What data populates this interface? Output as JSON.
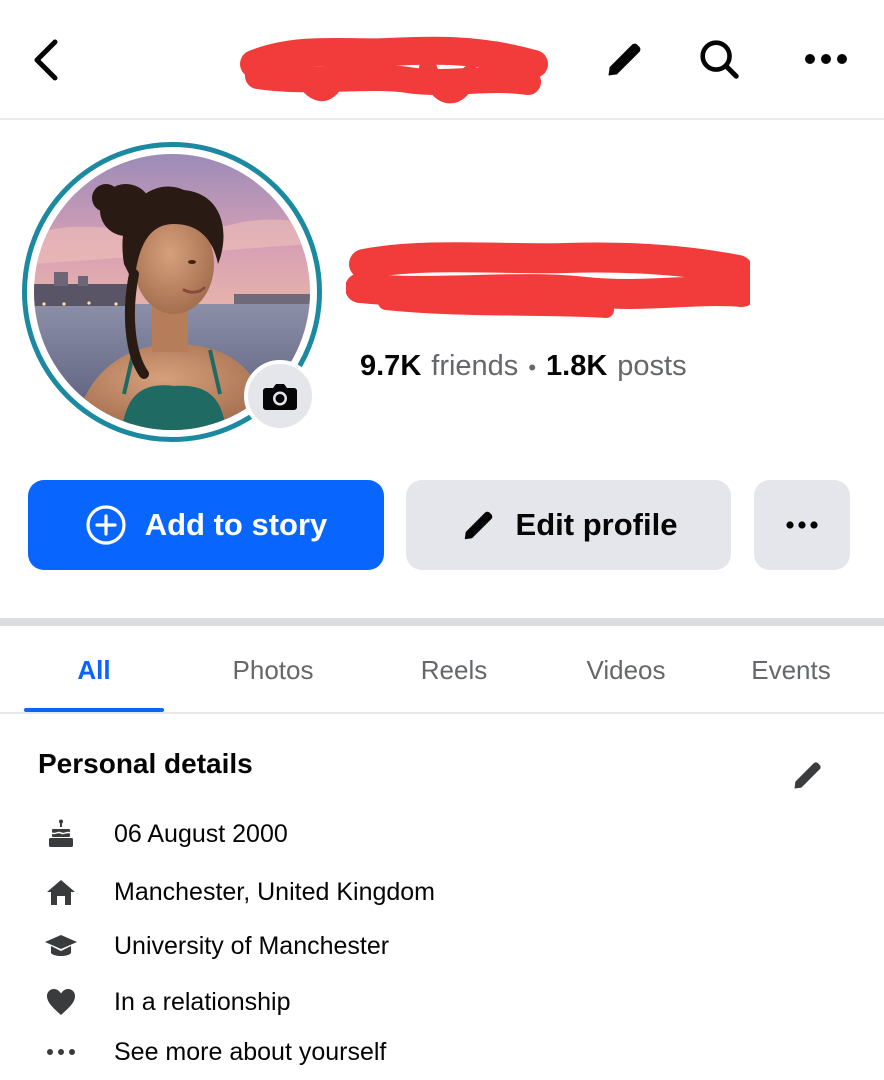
{
  "topbar": {
    "back_icon": "chevron-left-icon",
    "edit_icon": "pencil-icon",
    "search_icon": "search-icon",
    "more_icon": "more-dots-icon"
  },
  "profile": {
    "friends_count": "9.7K",
    "friends_label": "friends",
    "separator": "•",
    "posts_count": "1.8K",
    "posts_label": "posts"
  },
  "actions": {
    "add_story_label": "Add to story",
    "edit_profile_label": "Edit profile"
  },
  "tabs": [
    {
      "label": "All",
      "active": true
    },
    {
      "label": "Photos",
      "active": false
    },
    {
      "label": "Reels",
      "active": false
    },
    {
      "label": "Videos",
      "active": false
    },
    {
      "label": "Events",
      "active": false
    }
  ],
  "details": {
    "title": "Personal details",
    "items": [
      {
        "icon": "birthday-cake-icon",
        "text": "06 August 2000"
      },
      {
        "icon": "home-icon",
        "text": "Manchester, United Kingdom"
      },
      {
        "icon": "graduation-cap-icon",
        "text": "University of Manchester"
      },
      {
        "icon": "heart-icon",
        "text": "In a relationship"
      },
      {
        "icon": "more-dots-icon",
        "text": "See more about yourself"
      }
    ]
  },
  "colors": {
    "primary_blue": "#0866ff",
    "secondary_bg": "#e4e6eb",
    "redaction": "#f23b3b",
    "avatar_ring": "#1b8aa0"
  }
}
